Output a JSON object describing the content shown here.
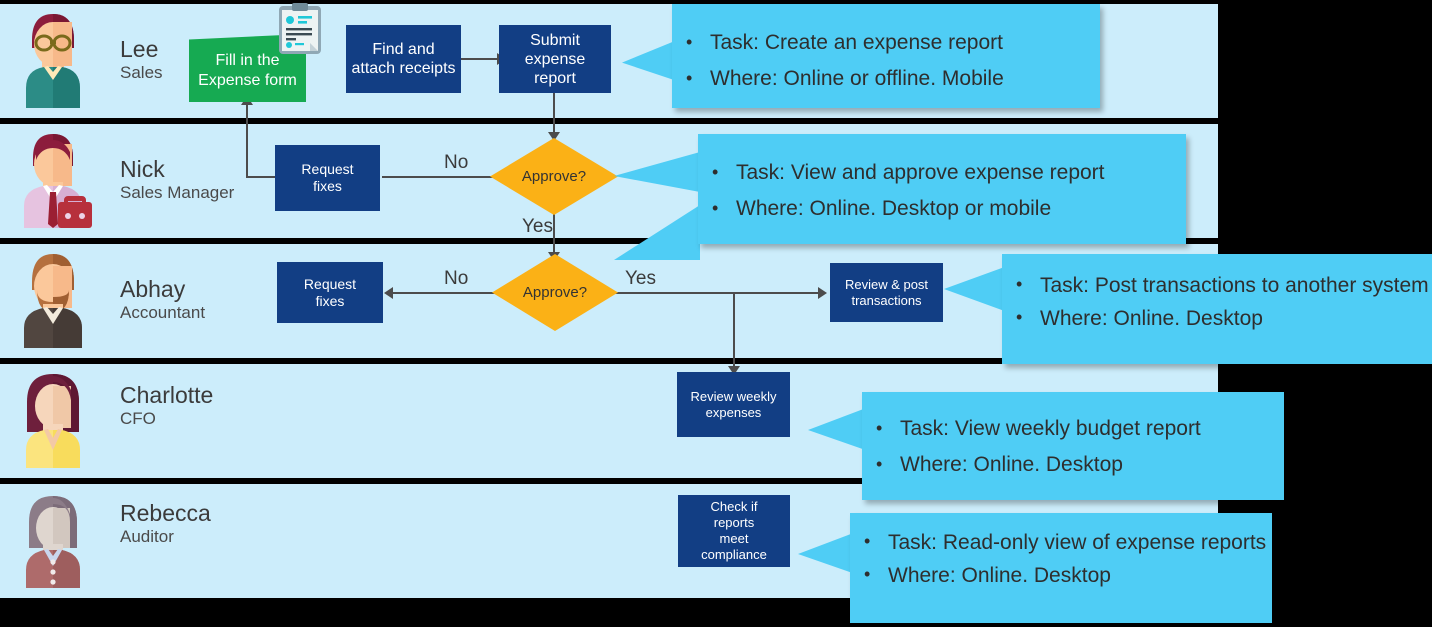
{
  "diagram": {
    "title": "Expense report process swimlane diagram",
    "colors": {
      "lane_background": "#CCEDFB",
      "page_background": "#000000",
      "node_blue": "#123E84",
      "node_green": "#16AA52",
      "decision_amber": "#FBB116",
      "callout_blue": "#4FCDF5",
      "connector_gray": "#4C4C4C"
    }
  },
  "lanes": [
    {
      "id": "lane-lee",
      "name": "Lee",
      "role": "Sales"
    },
    {
      "id": "lane-nick",
      "name": "Nick",
      "role": "Sales Manager"
    },
    {
      "id": "lane-abhay",
      "name": "Abhay",
      "role": "Accountant"
    },
    {
      "id": "lane-charlotte",
      "name": "Charlotte",
      "role": "CFO"
    },
    {
      "id": "lane-rebecca",
      "name": "Rebecca",
      "role": "Auditor"
    }
  ],
  "nodes": {
    "fill_expense_form": "Fill in the\nExpense form",
    "fill_expense_form_l1": "Fill in the",
    "fill_expense_form_l2": "Expense form",
    "find_attach_receipts_l1": "Find and",
    "find_attach_receipts_l2": "attach receipts",
    "submit_expense_report_l1": "Submit",
    "submit_expense_report_l2": "expense report",
    "request_fixes_manager_l1": "Request",
    "request_fixes_manager_l2": "fixes",
    "request_fixes_accountant_l1": "Request",
    "request_fixes_accountant_l2": "fixes",
    "approve_manager": "Approve?",
    "approve_accountant": "Approve?",
    "review_post_transactions_l1": "Review & post",
    "review_post_transactions_l2": "transactions",
    "review_weekly_expenses_l1": "Review weekly",
    "review_weekly_expenses_l2": "expenses",
    "check_compliance_l1": "Check if",
    "check_compliance_l2": "reports",
    "check_compliance_l3": "meet",
    "check_compliance_l4": "compliance"
  },
  "edge_labels": {
    "manager_no": "No",
    "manager_yes": "Yes",
    "accountant_no": "No",
    "accountant_yes": "Yes"
  },
  "callouts": [
    {
      "id": "callout-lee",
      "lines": [
        "Task: Create an expense report",
        "Where: Online or offline. Mobile"
      ]
    },
    {
      "id": "callout-nick",
      "lines": [
        "Task: View and approve expense report",
        "Where: Online. Desktop or mobile"
      ]
    },
    {
      "id": "callout-abhay",
      "lines": [
        "Task: Post transactions to another system",
        "Where: Online. Desktop"
      ]
    },
    {
      "id": "callout-charlotte",
      "lines": [
        "Task: View weekly budget report",
        "Where: Online. Desktop"
      ]
    },
    {
      "id": "callout-rebecca",
      "lines": [
        "Task: Read-only view of expense reports",
        "Where: Online. Desktop"
      ]
    }
  ],
  "icons": {
    "form_clipboard": "clipboard-form-icon",
    "avatar_lee": "avatar-lee-icon",
    "avatar_nick": "avatar-nick-icon",
    "avatar_abhay": "avatar-abhay-icon",
    "avatar_charlotte": "avatar-charlotte-icon",
    "avatar_rebecca": "avatar-rebecca-icon"
  }
}
